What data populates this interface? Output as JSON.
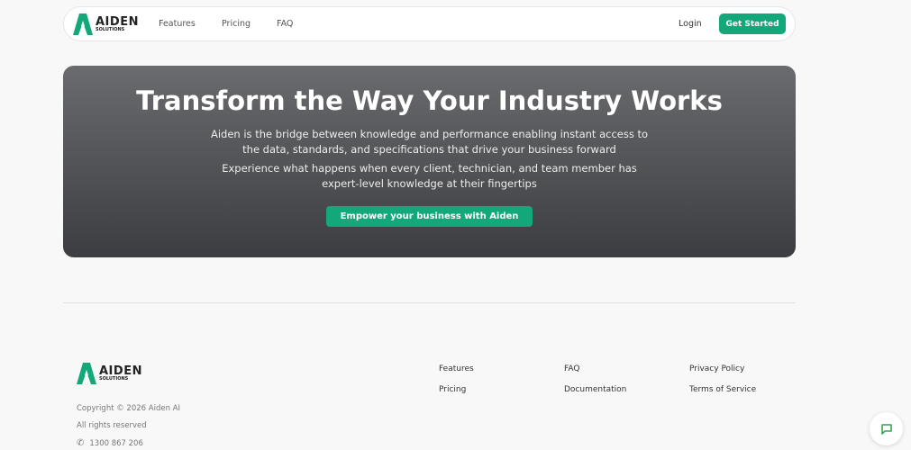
{
  "brand": {
    "name": "AIDEN",
    "sub": "SOLUTIONS"
  },
  "nav": {
    "links": [
      "Features",
      "Pricing",
      "FAQ"
    ],
    "login": "Login",
    "get_started": "Get Started"
  },
  "hero": {
    "title": "Transform the Way Your Industry Works",
    "p1": "Aiden is the bridge between knowledge and performance enabling instant access to the data, standards, and specifications that drive your business forward",
    "p2": "Experience what happens when every client, technician, and team member has expert-level knowledge at their fingertips",
    "cta": "Empower your business with Aiden"
  },
  "footer": {
    "copyright": "Copyright © 2026 Aiden AI",
    "rights": "All rights reserved",
    "phone": "1300 867 206",
    "links": [
      "Features",
      "Pricing",
      "FAQ",
      "Documentation",
      "Privacy Policy",
      "Terms of Service"
    ]
  },
  "colors": {
    "accent": "#12a87a"
  }
}
